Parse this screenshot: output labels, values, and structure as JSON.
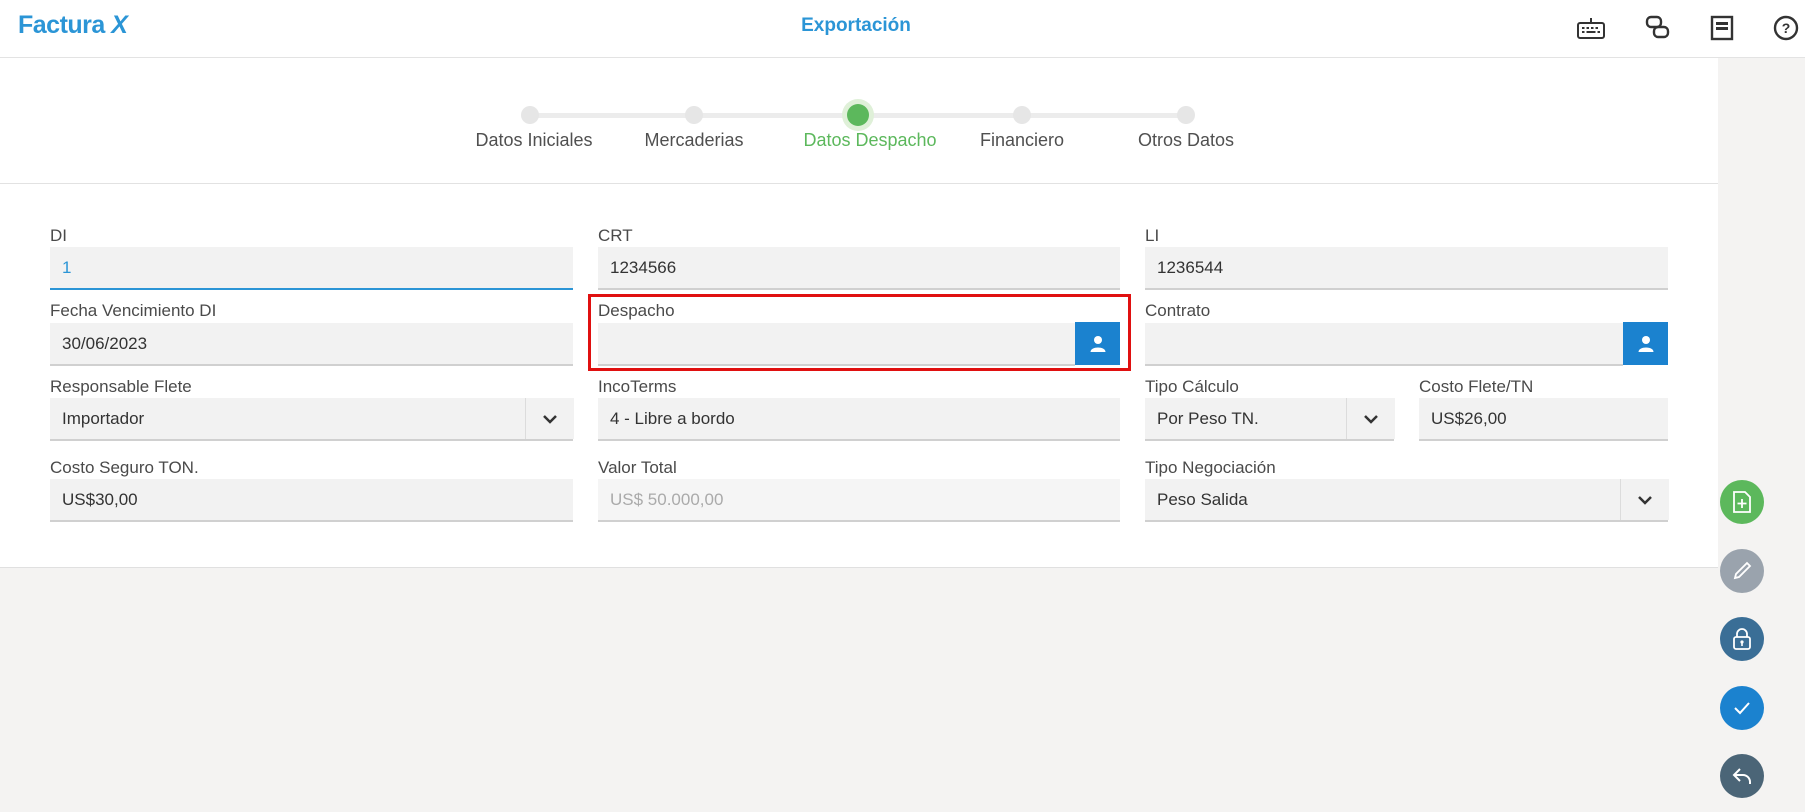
{
  "header": {
    "logo_text": "Factura",
    "logo_x": "X",
    "title": "Exportación",
    "icons": [
      "keyboard-icon",
      "chat-bubbles-icon",
      "document-icon",
      "help-icon"
    ]
  },
  "steps": [
    {
      "label": "Datos Iniciales",
      "active": false
    },
    {
      "label": "Mercaderias",
      "active": false
    },
    {
      "label": "Datos Despacho",
      "active": true
    },
    {
      "label": "Financiero",
      "active": false
    },
    {
      "label": "Otros Datos",
      "active": false
    }
  ],
  "form": {
    "di": {
      "label": "DI",
      "value": "1"
    },
    "crt": {
      "label": "CRT",
      "value": "1234566"
    },
    "li": {
      "label": "LI",
      "value": "1236544"
    },
    "fecha_venc": {
      "label": "Fecha Vencimiento DI",
      "value": "30/06/2023"
    },
    "despacho": {
      "label": "Despacho",
      "value": ""
    },
    "contrato": {
      "label": "Contrato",
      "value": ""
    },
    "responsable_flete": {
      "label": "Responsable Flete",
      "value": "Importador"
    },
    "incoterms": {
      "label": "IncoTerms",
      "value": "4 - Libre a bordo"
    },
    "tipo_calculo": {
      "label": "Tipo Cálculo",
      "value": "Por Peso TN."
    },
    "costo_flete": {
      "label": "Costo Flete/TN",
      "value": "US$26,00"
    },
    "costo_seguro": {
      "label": "Costo Seguro TON.",
      "value": "US$30,00"
    },
    "valor_total": {
      "label": "Valor Total",
      "value": "US$ 50.000,00"
    },
    "tipo_negociacion": {
      "label": "Tipo Negociación",
      "value": "Peso Salida"
    }
  },
  "colors": {
    "primary": "#2b95d6",
    "lookup_button": "#1b82cf",
    "step_active": "#5cb85c",
    "highlight": "#e01010",
    "fab_new": "#5cb85c",
    "fab_edit": "#9aa3ad",
    "fab_lock": "#3a6e96",
    "fab_confirm": "#1b82cf",
    "fab_back": "#4b6577"
  },
  "fabs": [
    "new-document-icon",
    "pencil-icon",
    "lock-icon",
    "check-icon",
    "undo-icon"
  ]
}
